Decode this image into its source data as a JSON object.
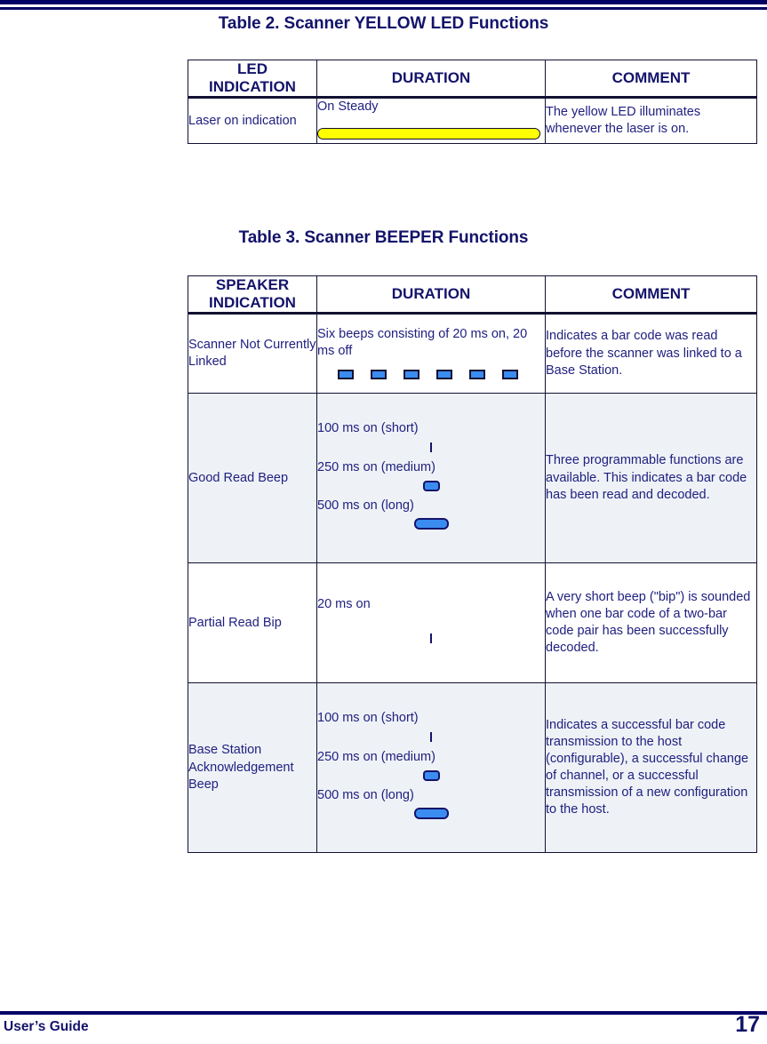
{
  "page": {
    "footer_left": "User’s Guide",
    "page_number": "17",
    "rule_color": "#000066",
    "text_color": "#1a1a6e",
    "tint_color": "#eef2f6"
  },
  "table2": {
    "title": "Table 2. Scanner YELLOW LED Functions",
    "headers": {
      "col1_line1": "LED",
      "col1_line2": "INDICATION",
      "col2": "DURATION",
      "col3": "COMMENT"
    },
    "rows": [
      {
        "indication": "Laser on indication",
        "duration_text": "On Steady",
        "duration_glyph": "steady-yellow-bar",
        "glyph_color": "#ffff00",
        "comment": "The yellow LED illuminates whenever the laser is on."
      }
    ]
  },
  "table3": {
    "title": "Table 3. Scanner BEEPER Functions",
    "headers": {
      "col1_line1": "SPEAKER",
      "col1_line2": "INDICATION",
      "col2": "DURATION",
      "col3": "COMMENT"
    },
    "glyph_color": "#3b8cf0",
    "rows": [
      {
        "indication": "Scanner Not Currently Linked",
        "duration_text": "Six beeps consisting of 20 ms on, 20 ms off",
        "duration_glyph": "six-beep-squares",
        "beep_count": 6,
        "comment": "Indicates a bar code was read before the scanner was linked to a Base Station.",
        "tinted": false
      },
      {
        "indication": "Good Read Beep",
        "duration_lines": [
          {
            "text": "100 ms on (short)",
            "glyph": "beep-short"
          },
          {
            "text": "250 ms on (medium)",
            "glyph": "beep-medium"
          },
          {
            "text": "500 ms on (long)",
            "glyph": "beep-long"
          }
        ],
        "comment": "Three programmable functions are available. This indicates a bar code has been read and decoded.",
        "tinted": true
      },
      {
        "indication": "Partial Read Bip",
        "duration_lines": [
          {
            "text": "20 ms on",
            "glyph": "beep-short"
          }
        ],
        "comment": "A very short beep (\"bip\") is sounded when one bar code of a two-bar code pair has been successfully decoded.",
        "tinted": false
      },
      {
        "indication": "Base Station Acknowledgement Beep",
        "duration_lines": [
          {
            "text": "100 ms on (short)",
            "glyph": "beep-short"
          },
          {
            "text": "250 ms on (medium)",
            "glyph": "beep-medium"
          },
          {
            "text": "500 ms on (long)",
            "glyph": "beep-long"
          }
        ],
        "comment": "Indicates a successful bar code transmission to the host (configurable), a successful change of channel, or a successful transmission of a new configuration to the host.",
        "tinted": true
      }
    ]
  }
}
